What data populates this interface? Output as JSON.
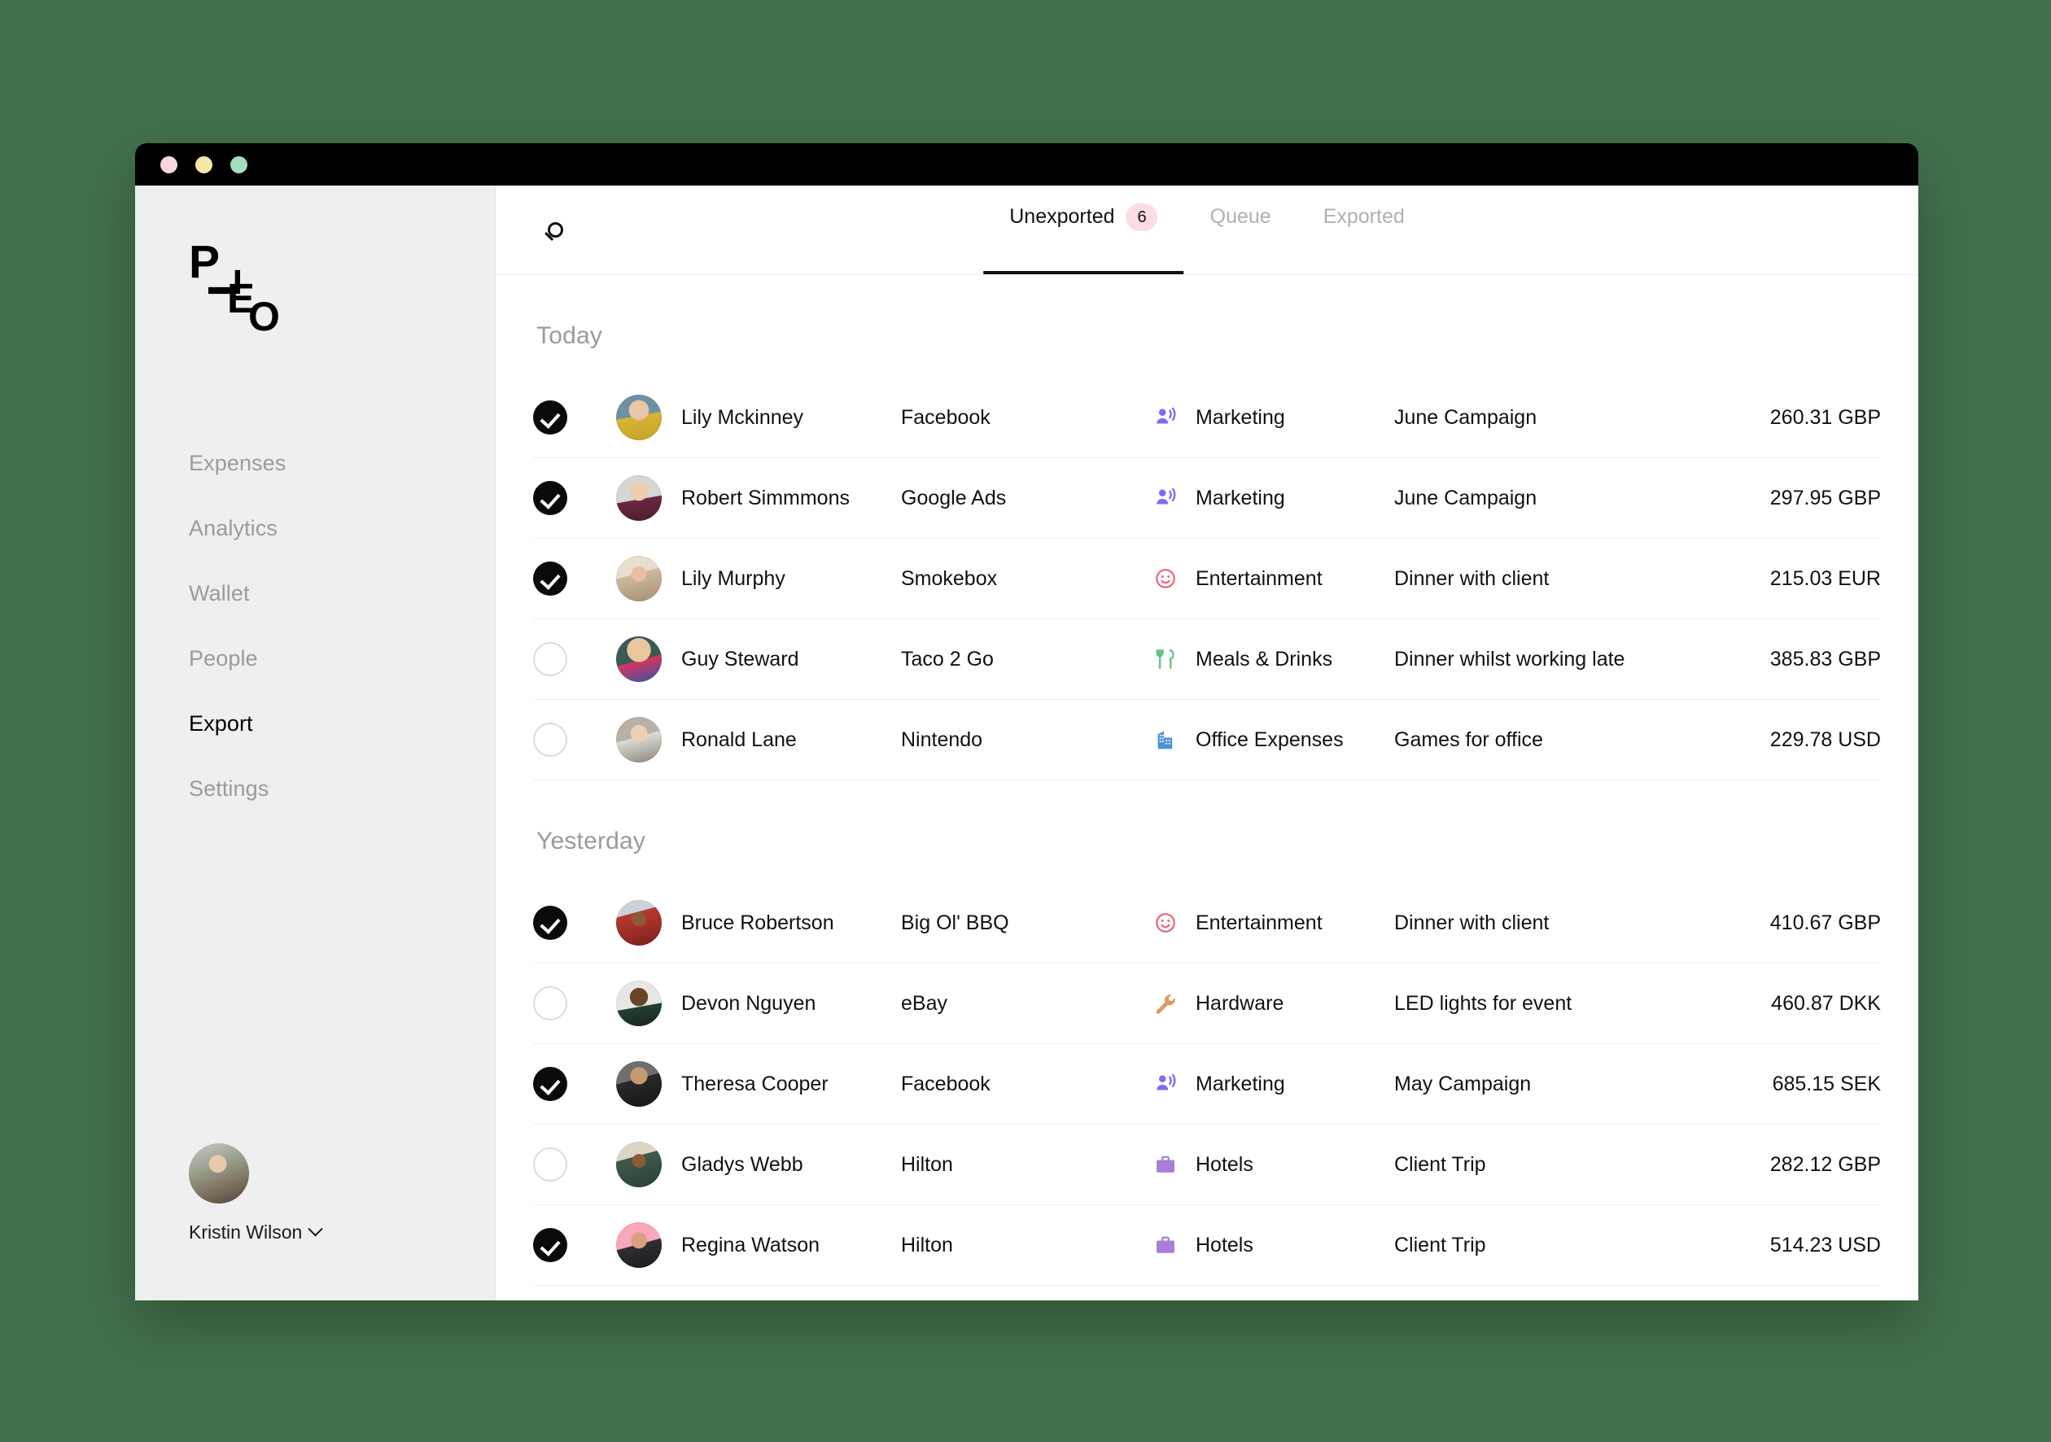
{
  "window": {
    "traffic_lights": [
      "close",
      "minimize",
      "maximize"
    ]
  },
  "sidebar": {
    "logo": {
      "letters": [
        "P",
        "L",
        "E",
        "O"
      ],
      "name": "Pleo"
    },
    "items": [
      {
        "label": "Expenses",
        "active": false
      },
      {
        "label": "Analytics",
        "active": false
      },
      {
        "label": "Wallet",
        "active": false
      },
      {
        "label": "People",
        "active": false
      },
      {
        "label": "Export",
        "active": true
      },
      {
        "label": "Settings",
        "active": false
      }
    ],
    "user": {
      "name": "Kristin Wilson",
      "chevron": "chevron-down-icon"
    }
  },
  "topbar": {
    "search_icon": "search-icon",
    "tabs": [
      {
        "label": "Unexported",
        "badge": "6",
        "active": true
      },
      {
        "label": "Queue",
        "badge": "",
        "active": false
      },
      {
        "label": "Exported",
        "badge": "",
        "active": false
      }
    ]
  },
  "colors": {
    "desktop_background": "#42704c",
    "titlebar": "#000000",
    "sidebar": "#efefef",
    "accent_badge": "#fbdde3",
    "active_text": "#111111",
    "muted_text": "#9b9b9b",
    "category_marketing": "#7c6cf0",
    "category_entertainment": "#e8697d",
    "category_meals": "#62c38a",
    "category_office": "#4a90d9",
    "category_hardware": "#dd9a63",
    "category_hotels": "#a97ed6"
  },
  "sections": [
    {
      "title": "Today",
      "rows": [
        {
          "checked": true,
          "avatar": "av-lilymckinney",
          "person": "Lily Mckinney",
          "merchant": "Facebook",
          "category": "Marketing",
          "category_icon": "marketing-icon",
          "description": "June Campaign",
          "amount": "260.31 GBP"
        },
        {
          "checked": true,
          "avatar": "av-robert",
          "person": "Robert Simmmons",
          "merchant": "Google Ads",
          "category": "Marketing",
          "category_icon": "marketing-icon",
          "description": "June Campaign",
          "amount": "297.95 GBP"
        },
        {
          "checked": true,
          "avatar": "av-lilymurphy",
          "person": "Lily Murphy",
          "merchant": "Smokebox",
          "category": "Entertainment",
          "category_icon": "entertainment-icon",
          "description": "Dinner with client",
          "amount": "215.03 EUR"
        },
        {
          "checked": false,
          "avatar": "av-guy",
          "person": "Guy Steward",
          "merchant": "Taco 2 Go",
          "category": "Meals & Drinks",
          "category_icon": "meals-icon",
          "description": "Dinner whilst working late",
          "amount": "385.83 GBP"
        },
        {
          "checked": false,
          "avatar": "av-ronald",
          "person": "Ronald Lane",
          "merchant": "Nintendo",
          "category": "Office Expenses",
          "category_icon": "office-icon",
          "description": "Games for office",
          "amount": "229.78 USD"
        }
      ]
    },
    {
      "title": "Yesterday",
      "rows": [
        {
          "checked": true,
          "avatar": "av-bruce",
          "person": "Bruce Robertson",
          "merchant": "Big Ol' BBQ",
          "category": "Entertainment",
          "category_icon": "entertainment-icon",
          "description": "Dinner with client",
          "amount": "410.67 GBP"
        },
        {
          "checked": false,
          "avatar": "av-devon",
          "person": "Devon Nguyen",
          "merchant": "eBay",
          "category": "Hardware",
          "category_icon": "hardware-icon",
          "description": "LED lights for event",
          "amount": "460.87 DKK"
        },
        {
          "checked": true,
          "avatar": "av-theresa",
          "person": "Theresa Cooper",
          "merchant": "Facebook",
          "category": "Marketing",
          "category_icon": "marketing-icon",
          "description": "May Campaign",
          "amount": "685.15 SEK"
        },
        {
          "checked": false,
          "avatar": "av-gladys",
          "person": "Gladys Webb",
          "merchant": "Hilton",
          "category": "Hotels",
          "category_icon": "hotels-icon",
          "description": "Client Trip",
          "amount": "282.12 GBP"
        },
        {
          "checked": true,
          "avatar": "av-regina",
          "person": "Regina Watson",
          "merchant": "Hilton",
          "category": "Hotels",
          "category_icon": "hotels-icon",
          "description": "Client Trip",
          "amount": "514.23 USD"
        }
      ]
    }
  ]
}
